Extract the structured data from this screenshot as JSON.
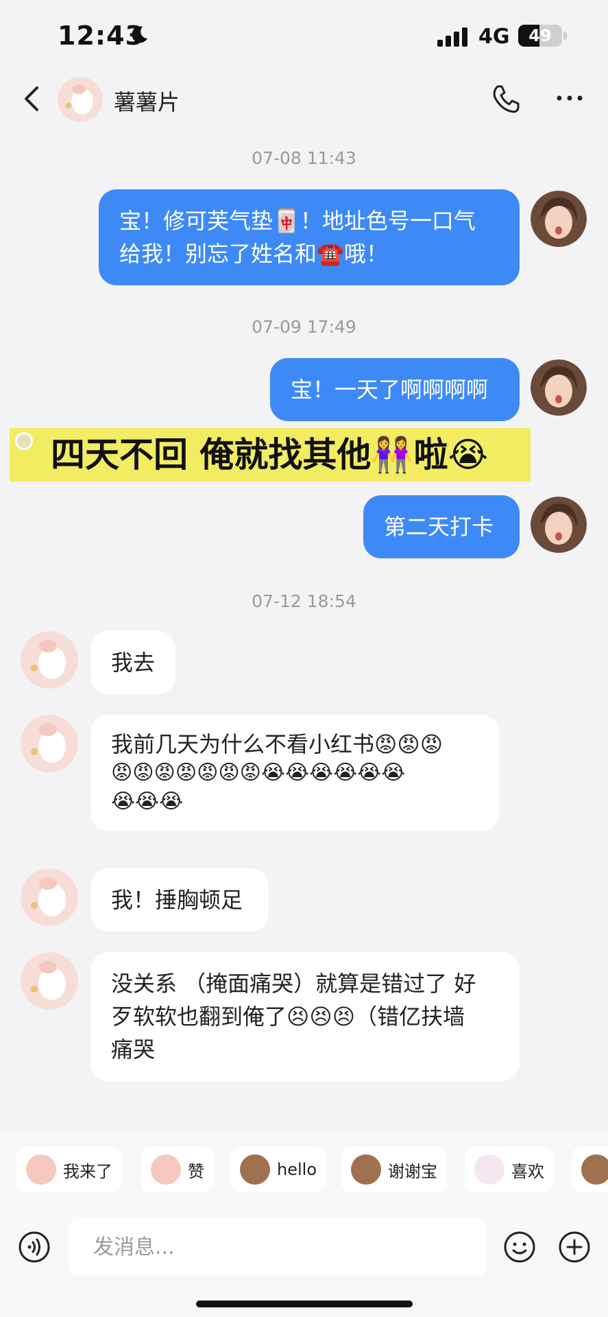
{
  "status_bar": {
    "time": "12:43",
    "network": "4G",
    "battery_text": "49",
    "battery_level": 0.49
  },
  "header": {
    "contact_name": "薯薯片"
  },
  "messages": [
    {
      "type": "timestamp",
      "text": "07-08 11:43"
    },
    {
      "type": "sent",
      "lines": [
        "宝！修可芙气垫🀄！地址色号一口气",
        "给我！别忘了姓名和☎️哦！"
      ]
    },
    {
      "type": "timestamp",
      "text": "07-09 17:49"
    },
    {
      "type": "sent",
      "lines": [
        "宝！一天了啊啊啊啊"
      ]
    },
    {
      "type": "banner",
      "text": "四天不回 俺就找其他👭啦😭"
    },
    {
      "type": "sent",
      "lines": [
        "第二天打卡"
      ]
    },
    {
      "type": "timestamp",
      "text": "07-12 18:54"
    },
    {
      "type": "received",
      "lines": [
        "我去"
      ]
    },
    {
      "type": "received",
      "lines": [
        "我前几天为什么不看小红书😡😡😡",
        "😡😡😡😡😡😡😡😭😭😭😭😭😭",
        "😭😭😭"
      ]
    },
    {
      "type": "received",
      "lines": [
        "我！捶胸顿足"
      ]
    },
    {
      "type": "received",
      "lines": [
        "没关系 （掩面痛哭）就算是错过了 好",
        "歹软软也翻到俺了😣😣😣（错亿扶墙",
        "痛哭"
      ]
    }
  ],
  "quick_replies": [
    "我来了",
    "赞",
    "hello",
    "谢谢宝",
    "喜欢"
  ],
  "input": {
    "placeholder": "发消息..."
  },
  "colors": {
    "sent_bubble": "#3d8af7",
    "received_bubble": "#ffffff",
    "background": "#f3f3f5",
    "banner": "#f2ec63"
  }
}
